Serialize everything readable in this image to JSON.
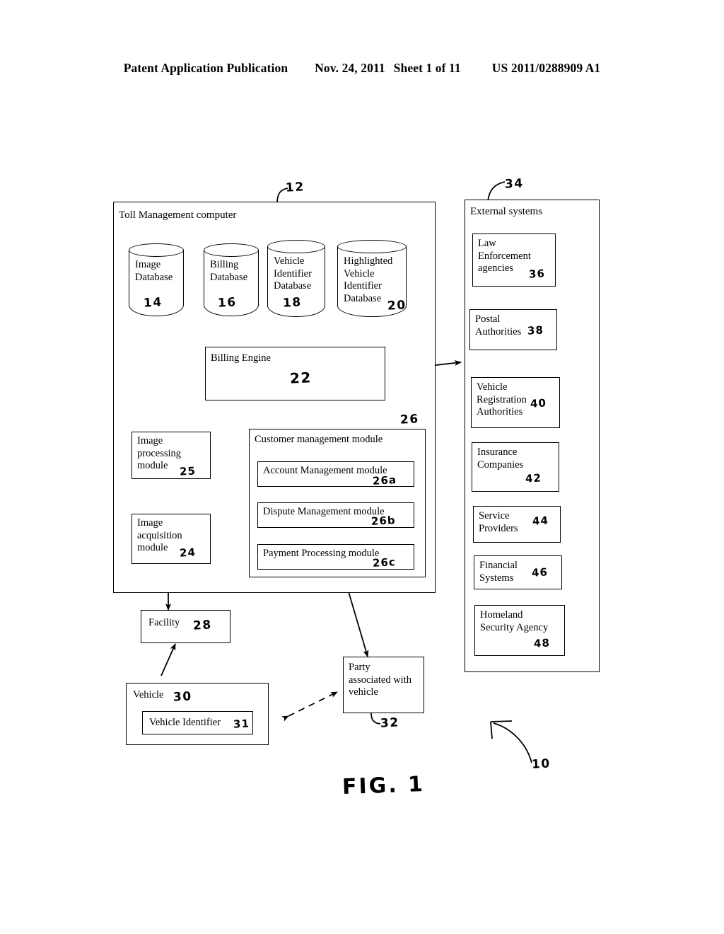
{
  "header": {
    "publication": "Patent Application Publication",
    "date": "Nov. 24, 2011",
    "sheet": "Sheet 1 of 11",
    "patent_number": "US 2011/0288909 A1"
  },
  "figure": {
    "caption": "FIG. 1",
    "system_numeral": "10"
  },
  "toll_computer": {
    "title": "Toll Management computer",
    "numeral": "12",
    "databases": [
      {
        "label": "Image\nDatabase",
        "numeral": "14"
      },
      {
        "label": "Billing\nDatabase",
        "numeral": "16"
      },
      {
        "label": "Vehicle\nIdentifier\nDatabase",
        "numeral": "18"
      },
      {
        "label": "Highlighted\nVehicle\nIdentifier\nDatabase",
        "numeral": "20"
      }
    ],
    "billing_engine": {
      "label": "Billing Engine",
      "numeral": "22"
    },
    "image_processing": {
      "label": "Image\nprocessing\nmodule",
      "numeral": "25"
    },
    "image_acquisition": {
      "label": "Image\nacquisition\nmodule",
      "numeral": "24"
    },
    "customer_management": {
      "label": "Customer management module",
      "numeral": "26",
      "submodules": [
        {
          "label": "Account Management module",
          "numeral": "26a"
        },
        {
          "label": "Dispute Management module",
          "numeral": "26b"
        },
        {
          "label": "Payment Processing module",
          "numeral": "26c"
        }
      ]
    }
  },
  "external_systems": {
    "title": "External systems",
    "numeral": "34",
    "items": [
      {
        "label": "Law\nEnforcement\nagencies",
        "numeral": "36"
      },
      {
        "label": "Postal\nAuthorities",
        "numeral": "38"
      },
      {
        "label": "Vehicle\nRegistration\nAuthorities",
        "numeral": "40"
      },
      {
        "label": "Insurance\nCompanies",
        "numeral": "42"
      },
      {
        "label": "Service\nProviders",
        "numeral": "44"
      },
      {
        "label": "Financial\nSystems",
        "numeral": "46"
      },
      {
        "label": "Homeland\nSecurity Agency",
        "numeral": "48"
      }
    ]
  },
  "field_entities": {
    "facility": {
      "label": "Facility",
      "numeral": "28"
    },
    "vehicle": {
      "label": "Vehicle",
      "numeral": "30"
    },
    "vehicle_identifier": {
      "label": "Vehicle Identifier",
      "numeral": "31"
    },
    "party": {
      "label": "Party\nassociated with\nvehicle",
      "numeral": "32"
    }
  }
}
